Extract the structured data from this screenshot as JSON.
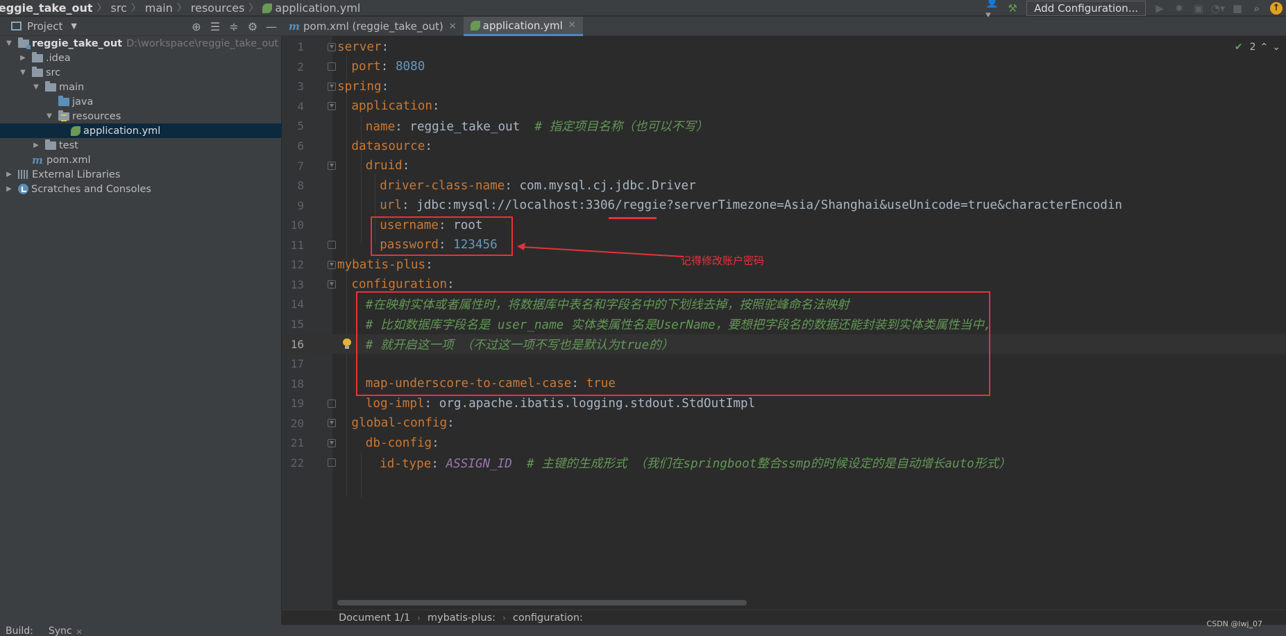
{
  "navbar": {
    "crumbs": [
      "reggie_take_out",
      "src",
      "main",
      "resources",
      "application.yml"
    ],
    "add_configuration": "Add Configuration..."
  },
  "project_panel": {
    "title": "Project",
    "tree": [
      {
        "label": "reggie_take_out",
        "path": "D:\\workspace\\reggie_take_out"
      },
      {
        "label": ".idea"
      },
      {
        "label": "src"
      },
      {
        "label": "main"
      },
      {
        "label": "java"
      },
      {
        "label": "resources"
      },
      {
        "label": "application.yml"
      },
      {
        "label": "test"
      },
      {
        "label": "pom.xml"
      },
      {
        "label": "External Libraries"
      },
      {
        "label": "Scratches and Consoles"
      }
    ]
  },
  "tabs": [
    {
      "label": "pom.xml (reggie_take_out)",
      "active": false
    },
    {
      "label": "application.yml",
      "active": true
    }
  ],
  "editor": {
    "inspection_count": "2",
    "current_line": 16,
    "lines": [
      {
        "no": "1",
        "key": "server",
        "sep": ":",
        "val": "",
        "comment": ""
      },
      {
        "no": "2",
        "key": "port",
        "sep": ": ",
        "val": "8080",
        "comment": ""
      },
      {
        "no": "3",
        "key": "spring",
        "sep": ":",
        "val": "",
        "comment": ""
      },
      {
        "no": "4",
        "key": "application",
        "sep": ":",
        "val": "",
        "comment": ""
      },
      {
        "no": "5",
        "key": "name",
        "sep": ": ",
        "val": "reggie_take_out",
        "comment": "  # 指定项目名称（也可以不写）"
      },
      {
        "no": "6",
        "key": "datasource",
        "sep": ":",
        "val": "",
        "comment": ""
      },
      {
        "no": "7",
        "key": "druid",
        "sep": ":",
        "val": "",
        "comment": ""
      },
      {
        "no": "8",
        "key": "driver-class-name",
        "sep": ": ",
        "val": "com.mysql.cj.jdbc.Driver",
        "comment": ""
      },
      {
        "no": "9",
        "key": "url",
        "sep": ": ",
        "val": "jdbc:mysql://localhost:3306/reggie?serverTimezone=Asia/Shanghai&useUnicode=true&characterEncodin",
        "comment": ""
      },
      {
        "no": "10",
        "key": "username",
        "sep": ": ",
        "val": "root",
        "comment": ""
      },
      {
        "no": "11",
        "key": "password",
        "sep": ": ",
        "val": "123456",
        "comment": ""
      },
      {
        "no": "12",
        "key": "mybatis-plus",
        "sep": ":",
        "val": "",
        "comment": ""
      },
      {
        "no": "13",
        "key": "configuration",
        "sep": ":",
        "val": "",
        "comment": ""
      },
      {
        "no": "14",
        "key": "",
        "sep": "",
        "val": "",
        "comment": "#在映射实体或者属性时，将数据库中表名和字段名中的下划线去掉，按照驼峰命名法映射"
      },
      {
        "no": "15",
        "key": "",
        "sep": "",
        "val": "",
        "comment": "# 比如数据库字段名是 user_name 实体类属性名是UserName，要想把字段名的数据还能封装到实体类属性当中,"
      },
      {
        "no": "16",
        "key": "",
        "sep": "",
        "val": "",
        "comment": "# 就开启这一项 （不过这一项不写也是默认为true的）"
      },
      {
        "no": "17",
        "key": "",
        "sep": "",
        "val": "",
        "comment": ""
      },
      {
        "no": "18",
        "key": "map-underscore-to-camel-case",
        "sep": ": ",
        "val": "true",
        "comment": ""
      },
      {
        "no": "19",
        "key": "log-impl",
        "sep": ": ",
        "val": "org.apache.ibatis.logging.stdout.StdOutImpl",
        "comment": ""
      },
      {
        "no": "20",
        "key": "global-config",
        "sep": ":",
        "val": "",
        "comment": ""
      },
      {
        "no": "21",
        "key": "db-config",
        "sep": ":",
        "val": "",
        "comment": ""
      },
      {
        "no": "22",
        "key": "id-type",
        "sep": ": ",
        "val": "ASSIGN_ID",
        "comment": "  # 主键的生成形式 （我们在springboot整合ssmp的时候设定的是自动增长auto形式）"
      }
    ]
  },
  "annotation": {
    "note": "记得修改账户密码"
  },
  "editor_breadcrumbs": [
    "Document 1/1",
    "mybatis-plus:",
    "configuration:"
  ],
  "bottom_bar": {
    "build": "Build:",
    "sync": "Sync"
  },
  "watermark": "CSDN @lwj_07",
  "colors": {
    "key": "#cc7832",
    "number": "#6897bb",
    "comment": "#629755",
    "enum": "#9876aa",
    "annotation": "#e8323a",
    "selection": "#0d293e"
  }
}
